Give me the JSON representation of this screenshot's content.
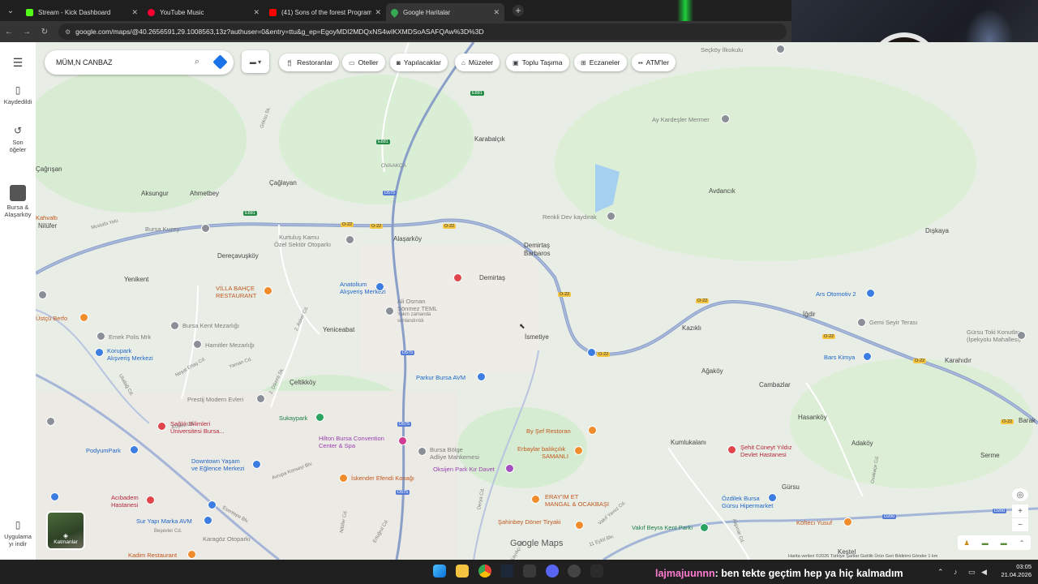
{
  "browser": {
    "tabs": [
      {
        "label": "Stream - Kick Dashboard",
        "color": "#53fc18"
      },
      {
        "label": "YouTube Music",
        "color": "#ff0033"
      },
      {
        "label": "(41) Sons of the forest Program",
        "color": "#ff0000"
      },
      {
        "label": "Google Haritalar",
        "color": "#34a853"
      }
    ],
    "url": "google.com/maps/@40.2656591,29.1008563,13z?authuser=0&entry=ttu&g_ep=EgoyMDI2MDQxNS4wIKXMDSoASAFQAw%3D%3D"
  },
  "sidebar": {
    "saved": "Kaydedildi",
    "recent_line1": "Son",
    "recent_line2": "öğeler",
    "recent_place_line1": "Bursa &",
    "recent_place_line2": "Alaşarköy",
    "apps_line1": "Uygulama",
    "apps_line2": "yı indir"
  },
  "search": {
    "value": "MÜM,N CANBAZ"
  },
  "chips": [
    "Restoranlar",
    "Oteller",
    "Yapılacaklar",
    "Müzeler",
    "Toplu Taşıma",
    "Eczaneler",
    "ATM'ler"
  ],
  "map": {
    "labels": {
      "karabalcik": "Karabalçık",
      "avdancik": "Avdancık",
      "diskaya": "Dışkaya",
      "aykardesler": "Ay Kardeşler Mermer",
      "seckoy": "Seçköy İlkokulu",
      "cagrisan": "Çağrışan",
      "aksungur": "Aksungur",
      "ahmetbey": "Ahmetbey",
      "caglayan": "Çağlayan",
      "ovaakca": "OVAAKÇA",
      "renkli": "Renkli Dev kaydırak",
      "kahvalti": "Kahvaltı",
      "nilufer": "Nilüfer",
      "bursakuzey": "Bursa Kuzey",
      "kurtuluskamu": "Kurtuluş Kamu",
      "ozelsektor": "Özel Sektör Otoparkı",
      "alasarkoy": "Alaşarköy",
      "demirtasbarbaros1": "Demirtaş",
      "demirtasbarbaros2": "Barbaros",
      "derecavuskoy": "Dereçavuşköy",
      "demirtas": "Demirtaş",
      "yenikent": "Yenikent",
      "villabahce1": "VİLLA BAHÇE",
      "villabahce2": "RESTAURANT",
      "anatolium1": "Anatolium",
      "anatolium2": "Alışveriş Merkezi",
      "aliosman1": "Ali Osman",
      "aliosman2": "Sönmez TEML",
      "aliosman3": "Yakın zamanda",
      "aliosman4": "sonlandırıldı",
      "arsotomotiv": "Ars Otomotiv 2",
      "igdir": "İğdir",
      "gemiseyir": "Gemi Seyir Terası",
      "gursutoki1": "Gürsu Toki Konutları",
      "gursutoki2": "(İpekyolu Mahallesi)",
      "kazikli": "Kazıklı",
      "barskimya": "Bars Kimya",
      "karahidir": "Karahıdır",
      "ustoberfo": "Üstçü Berfo",
      "emekpolis": "Emek Polis Mrk",
      "bursakentmez": "Bursa Kent Mezarlığı",
      "yeniceabat": "Yeniceabat",
      "ismetiye": "İsmetiye",
      "korupark1": "Korupark",
      "korupark2": "Alışveriş Merkezi",
      "hamitler": "Hamitler Mezarlığı",
      "agakoy": "Ağaköy",
      "cambazlar": "Cambazlar",
      "celtikkoy": "Çeltikköy",
      "parkurbursa": "Parkur Bursa AVM",
      "prestij": "Prestij Modern Evleri",
      "hasankoy": "Hasanköy",
      "barak": "Barak",
      "saglik1": "Sağlık Bilimleri",
      "saglik2": "Üniversitesi Bursa...",
      "sukaypark": "Sukaypark",
      "bysef": "By Şef Restoran",
      "kumlukalani": "Kumlukalanı",
      "sehitcuneyt1": "Şehit Cüneyt Yıldız",
      "sehitcuneyt2": "Devlet Hastanesi",
      "adakoy": "Adaköy",
      "serme": "Serme",
      "hilton1": "Hilton Bursa Convention",
      "hilton2": "Center & Spa",
      "bursabolge1": "Bursa Bölge",
      "bursabolge2": "Adliye Mahkemesi",
      "erbaylar1": "Erbaylar balıkçılık",
      "erbaylar2": "SAMANLI",
      "podyum": "PodyumPark",
      "downtown1": "Downtown Yaşam",
      "downtown2": "ve Eğlence Merkezi",
      "iskender": "İskender Efendi Konağı",
      "oksijen": "Oksijen Park Kır Davet",
      "gursu": "Gürsu",
      "eraym1": "ERAY'IM ET",
      "eraym2": "MANGAL & OCAKBAŞI",
      "ozdilek1": "Özdilek Bursa",
      "ozdilek2": "Gürsu Hipermarket",
      "acibadem1": "Acıbadem",
      "acibadem2": "Hastanesi",
      "suryapi": "Sur Yapı Marka AVM",
      "sahinbey": "Şahinbey Döner Tiryaki",
      "vakifbeyra": "Vakıf Beyra Kent Parkı",
      "koftecyusuf": "Köftecı Yusuf",
      "karagoz": "Karagöz Otoparkı",
      "kadim": "Kadim Restaurant",
      "kestel": "Kestel",
      "mustafayolu": "Mustafa Yolu",
      "goksu": "Göksu Sk.",
      "uludag": "Uludağ Cd.",
      "nesatertas": "Neşat Ertaş Cd.",
      "yaman": "Yaman Cd.",
      "asker": "2. Asker Cd.",
      "kayikci": "Kayıkçı Sk.",
      "dikenli": "2. Dikenli Sk.",
      "ankaraa": "Akpınar Cd.",
      "ayvalik": "Avrupa Konseyi Blv.",
      "esentepe": "Esentepe Blv.",
      "yavuz": "Vakıf Yavuz Cd.",
      "ilk11": "11 Eylül Blv.",
      "derya": "Derya Cd.",
      "besevler": "Beşevler Cd.",
      "nilcad": "Nilüfer Cd.",
      "ertugrul": "Ertuğrul Cd.",
      "korfez": "Körfez Cd.",
      "ankara": "Ankara Yolu",
      "evcad": "Fenerbahçe Blv.",
      "ovak": "Ovakaçe Cd."
    },
    "shields": {
      "o22": "O-22",
      "d575": "D575",
      "d200": "D200",
      "e881": "E881"
    }
  },
  "layers_label": "Katmanlar",
  "google_maps_logo": "Google Maps",
  "bottom_info": "Harita verileri ©2026    Türkiye    Şartlar    Gizlilik    Ürün Geri Bildirimi Gönder    1 km",
  "chat": {
    "user": "lajmajuunnn",
    "message": ": ben tekte geçtim hep ya hiç kalmadım"
  },
  "clock": {
    "time": "03:05",
    "date": "21.04.2026"
  }
}
